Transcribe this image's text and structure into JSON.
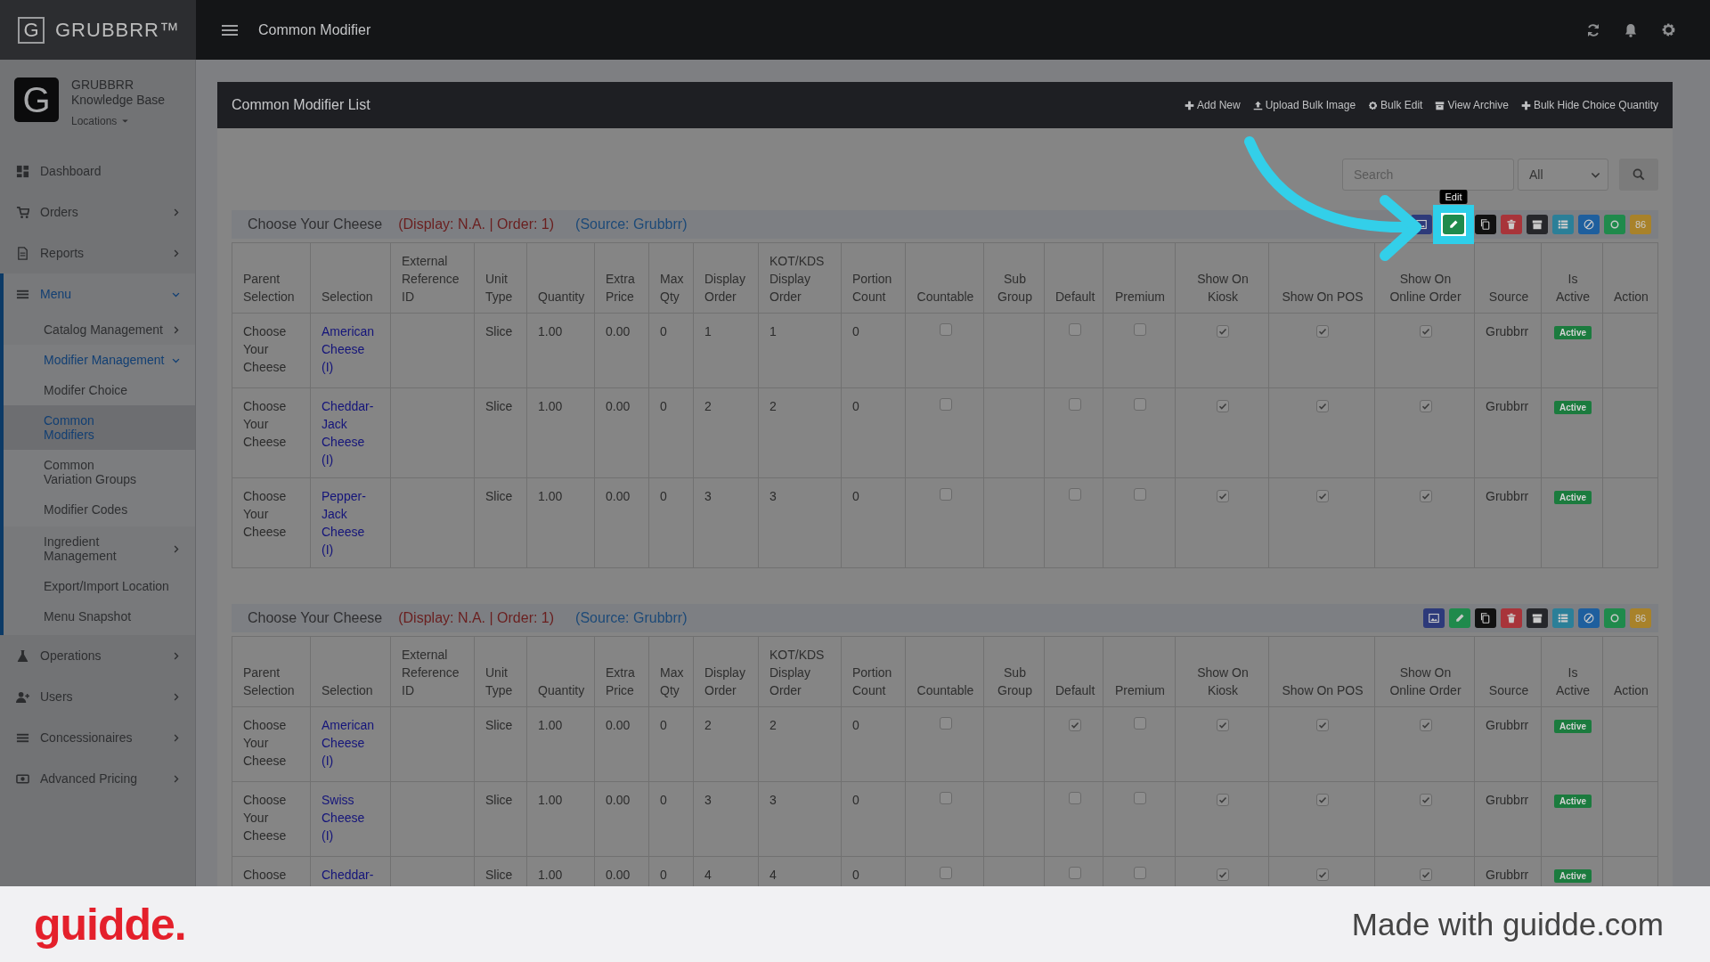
{
  "top_bar": {
    "logo_letter": "G",
    "brand": "GRUBBRR™",
    "page_title": "Common Modifier"
  },
  "sidebar": {
    "profile": {
      "avatar_letter": "G",
      "name": "GRUBBRR Knowledge Base",
      "locations": "Locations"
    },
    "items": [
      {
        "label": "Dashboard",
        "selected": false
      },
      {
        "label": "Orders",
        "expanded": false,
        "selected": false
      },
      {
        "label": "Reports",
        "expanded": false,
        "selected": false
      },
      {
        "label": "Menu",
        "expanded": true,
        "selected": false,
        "children": [
          {
            "label": "Catalog Management",
            "expanded": false,
            "selected": false
          },
          {
            "label": "Modifier Management",
            "expanded": true,
            "selected": false,
            "children": [
              {
                "label": "Modifer Choice",
                "selected": false
              },
              {
                "label": "Common Modifiers",
                "selected": true
              },
              {
                "label": "Common Variation Groups",
                "selected": false
              },
              {
                "label": "Modifier Codes",
                "selected": false
              }
            ]
          },
          {
            "label": "Ingredient Management",
            "expanded": false,
            "selected": false
          },
          {
            "label": "Export/Import Location",
            "selected": false
          },
          {
            "label": "Menu Snapshot",
            "selected": false
          }
        ]
      },
      {
        "label": "Operations",
        "expanded": false,
        "selected": false
      },
      {
        "label": "Users",
        "expanded": false,
        "selected": false
      },
      {
        "label": "Concessionaires",
        "expanded": false,
        "selected": false
      },
      {
        "label": "Advanced Pricing",
        "expanded": false,
        "selected": false
      }
    ]
  },
  "panel": {
    "title": "Common Modifier List",
    "actions": [
      "Add New",
      "Upload Bulk Image",
      "Bulk Edit",
      "View Archive",
      "Bulk Hide Choice Quantity"
    ],
    "search": {
      "placeholder": "Search"
    },
    "filter": {
      "value": "All"
    },
    "groups": [
      {
        "title": "Choose Your Cheese",
        "meta": "(Display: N.A. | Order: 1)",
        "source": "(Source: Grubbrr)",
        "buttons": [
          {
            "kind": "image",
            "color": "#2d3a7a",
            "highlighted": false
          },
          {
            "kind": "edit",
            "color": "#1f8a4c",
            "highlighted": true,
            "tooltip": "Edit"
          },
          {
            "kind": "copy",
            "color": "#111111",
            "highlighted": false
          },
          {
            "kind": "delete",
            "color": "#a8343a",
            "highlighted": false
          },
          {
            "kind": "archive",
            "color": "#26272b",
            "highlighted": false
          },
          {
            "kind": "list",
            "color": "#2b7f98",
            "highlighted": false
          },
          {
            "kind": "link",
            "color": "#1e5f9e",
            "highlighted": false
          },
          {
            "kind": "toggle",
            "color": "#1f8a4c",
            "highlighted": false
          },
          {
            "kind": "text",
            "label": "86",
            "color": "#a8822a",
            "highlighted": false
          }
        ],
        "columns": [
          "Parent Selection",
          "Selection",
          "External Reference ID",
          "Unit Type",
          "Quantity",
          "Extra Price",
          "Max Qty",
          "Display Order",
          "KOT/KDS Display Order",
          "Portion Count",
          "Countable",
          "Sub Group",
          "Default",
          "Premium",
          "Show On Kiosk",
          "Show On POS",
          "Show On Online Order",
          "Source",
          "Is Active",
          "Action"
        ],
        "rows": [
          {
            "parent": "Choose Your Cheese",
            "selection": "American Cheese (I)",
            "unit_type": "Slice",
            "quantity": "1.00",
            "extra_price": "0.00",
            "max_qty": "0",
            "display_order": "1",
            "kot_display_order": "1",
            "portion_count": "0",
            "countable": false,
            "default": false,
            "premium": false,
            "show_on_kiosk": true,
            "show_on_pos": true,
            "show_on_online_order": true,
            "source": "Grubbrr",
            "status": "Active"
          },
          {
            "parent": "Choose Your Cheese",
            "selection": "Cheddar-Jack Cheese (I)",
            "unit_type": "Slice",
            "quantity": "1.00",
            "extra_price": "0.00",
            "max_qty": "0",
            "display_order": "2",
            "kot_display_order": "2",
            "portion_count": "0",
            "countable": false,
            "default": false,
            "premium": false,
            "show_on_kiosk": true,
            "show_on_pos": true,
            "show_on_online_order": true,
            "source": "Grubbrr",
            "status": "Active"
          },
          {
            "parent": "Choose Your Cheese",
            "selection": "Pepper-Jack Cheese (I)",
            "unit_type": "Slice",
            "quantity": "1.00",
            "extra_price": "0.00",
            "max_qty": "0",
            "display_order": "3",
            "kot_display_order": "3",
            "portion_count": "0",
            "countable": false,
            "default": false,
            "premium": false,
            "show_on_kiosk": true,
            "show_on_pos": true,
            "show_on_online_order": true,
            "source": "Grubbrr",
            "status": "Active"
          }
        ]
      },
      {
        "title": "Choose Your Cheese",
        "meta": "(Display: N.A. | Order: 1)",
        "source": "(Source: Grubbrr)",
        "buttons": [
          {
            "kind": "image",
            "color": "#2d3a7a",
            "highlighted": false
          },
          {
            "kind": "edit",
            "color": "#1f8a4c",
            "highlighted": false
          },
          {
            "kind": "copy",
            "color": "#111111",
            "highlighted": false
          },
          {
            "kind": "delete",
            "color": "#a8343a",
            "highlighted": false
          },
          {
            "kind": "archive",
            "color": "#26272b",
            "highlighted": false
          },
          {
            "kind": "list",
            "color": "#2b7f98",
            "highlighted": false
          },
          {
            "kind": "link",
            "color": "#1e5f9e",
            "highlighted": false
          },
          {
            "kind": "toggle",
            "color": "#1f8a4c",
            "highlighted": false
          },
          {
            "kind": "text",
            "label": "86",
            "color": "#a8822a",
            "highlighted": false
          }
        ],
        "columns": [
          "Parent Selection",
          "Selection",
          "External Reference ID",
          "Unit Type",
          "Quantity",
          "Extra Price",
          "Max Qty",
          "Display Order",
          "KOT/KDS Display Order",
          "Portion Count",
          "Countable",
          "Sub Group",
          "Default",
          "Premium",
          "Show On Kiosk",
          "Show On POS",
          "Show On Online Order",
          "Source",
          "Is Active",
          "Action"
        ],
        "rows": [
          {
            "parent": "Choose Your Cheese",
            "selection": "American Cheese (I)",
            "unit_type": "Slice",
            "quantity": "1.00",
            "extra_price": "0.00",
            "max_qty": "0",
            "display_order": "2",
            "kot_display_order": "2",
            "portion_count": "0",
            "countable": false,
            "default": true,
            "premium": false,
            "show_on_kiosk": true,
            "show_on_pos": true,
            "show_on_online_order": true,
            "source": "Grubbrr",
            "status": "Active"
          },
          {
            "parent": "Choose Your Cheese",
            "selection": "Swiss Cheese (I)",
            "unit_type": "Slice",
            "quantity": "1.00",
            "extra_price": "0.00",
            "max_qty": "0",
            "display_order": "3",
            "kot_display_order": "3",
            "portion_count": "0",
            "countable": false,
            "default": false,
            "premium": false,
            "show_on_kiosk": true,
            "show_on_pos": true,
            "show_on_online_order": true,
            "source": "Grubbrr",
            "status": "Active"
          },
          {
            "parent": "Choose",
            "selection": "Cheddar-",
            "unit_type": "Slice",
            "quantity": "1.00",
            "extra_price": "0.00",
            "max_qty": "0",
            "display_order": "4",
            "kot_display_order": "4",
            "portion_count": "0",
            "countable": false,
            "default": false,
            "premium": false,
            "show_on_kiosk": true,
            "show_on_pos": true,
            "show_on_online_order": true,
            "source": "Grubbrr",
            "status": "Active"
          }
        ]
      }
    ]
  },
  "footer": {
    "logo": "guidde.",
    "credit": "Made with guidde.com"
  }
}
